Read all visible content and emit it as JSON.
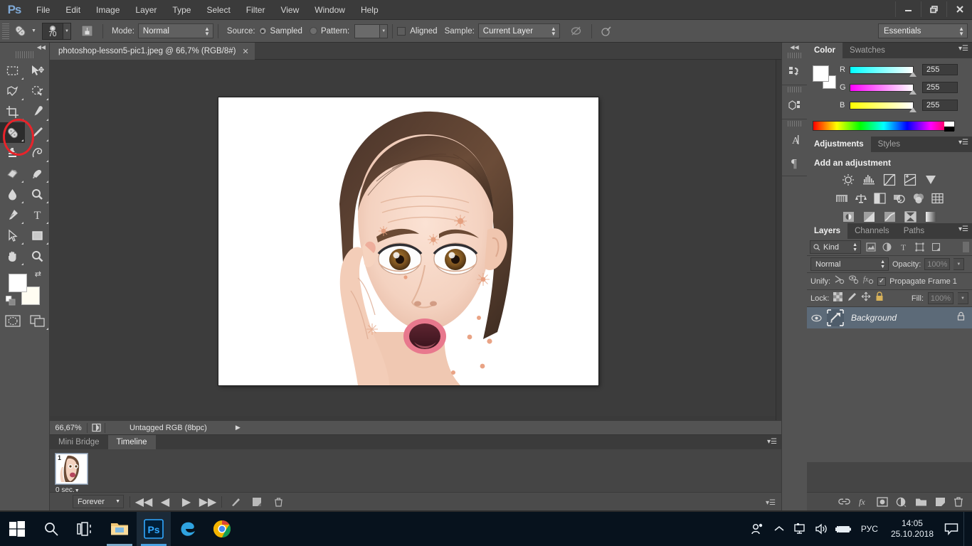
{
  "app": {
    "logo": "Ps",
    "menus": [
      "File",
      "Edit",
      "Image",
      "Layer",
      "Type",
      "Select",
      "Filter",
      "View",
      "Window",
      "Help"
    ],
    "window_controls": {
      "minimize": "—",
      "restore": "❐",
      "close": "✕"
    }
  },
  "options_bar": {
    "tool_icon": "healing-brush-icon",
    "brush_size": "70",
    "brush_preset_icon": "brush-preset-icon",
    "mode_label": "Mode:",
    "mode_value": "Normal",
    "source_label": "Source:",
    "source_sampled": "Sampled",
    "source_pattern": "Pattern:",
    "aligned_label": "Aligned",
    "sample_label": "Sample:",
    "sample_value": "Current Layer",
    "ignore_adjustment_icon": "ignore-adjustment-layers-icon",
    "airbrush_icon": "tablet-pressure-icon",
    "workspace": "Essentials"
  },
  "toolbox": {
    "tools": [
      {
        "name": "rectangular-marquee-tool",
        "selected": false
      },
      {
        "name": "move-tool",
        "selected": false
      },
      {
        "name": "lasso-tool",
        "selected": false
      },
      {
        "name": "quick-selection-tool",
        "selected": false
      },
      {
        "name": "crop-tool",
        "selected": false
      },
      {
        "name": "eyedropper-tool",
        "selected": false
      },
      {
        "name": "spot-healing-brush-tool",
        "selected": true
      },
      {
        "name": "brush-tool",
        "selected": false
      },
      {
        "name": "clone-stamp-tool",
        "selected": false
      },
      {
        "name": "history-brush-tool",
        "selected": false
      },
      {
        "name": "eraser-tool",
        "selected": false
      },
      {
        "name": "gradient-tool",
        "selected": false
      },
      {
        "name": "blur-tool",
        "selected": false
      },
      {
        "name": "dodge-tool",
        "selected": false
      },
      {
        "name": "pen-tool",
        "selected": false
      },
      {
        "name": "type-tool",
        "selected": false
      },
      {
        "name": "path-selection-tool",
        "selected": false
      },
      {
        "name": "rectangle-tool",
        "selected": false
      },
      {
        "name": "hand-tool",
        "selected": false
      },
      {
        "name": "zoom-tool",
        "selected": false
      }
    ],
    "foreground_color": "#ffffff",
    "background_color": "#fffdf2",
    "quick_mask": "quick-mask-icon",
    "screen_mode": "screen-mode-icon"
  },
  "document": {
    "tab_title": "photoshop-lesson5-pic1.jpeg @ 66,7% (RGB/8#)",
    "tab_close": "✕"
  },
  "status_bar": {
    "zoom": "66,67%",
    "doc_icon": "document-profile-icon",
    "color_profile": "Untagged RGB (8bpc)",
    "expand_arrow": "▶"
  },
  "timeline": {
    "tabs": [
      {
        "label": "Mini Bridge",
        "active": false
      },
      {
        "label": "Timeline",
        "active": true
      }
    ],
    "frames": [
      {
        "number": "1",
        "delay": "0 sec."
      }
    ],
    "loop": "Forever",
    "controls": [
      "select-first-frame",
      "select-previous-frame",
      "play-animation",
      "select-next-frame"
    ],
    "tween_icon": "tween-icon",
    "duplicate_icon": "duplicate-frame-icon",
    "delete_icon": "delete-frame-icon"
  },
  "dock_strip": {
    "icons": [
      "history-icon",
      "properties-3d-icon",
      "character-icon",
      "paragraph-icon"
    ],
    "collapse": "◀◀"
  },
  "color_panel": {
    "tabs": [
      {
        "label": "Color",
        "active": true
      },
      {
        "label": "Swatches",
        "active": false
      }
    ],
    "channels": [
      {
        "label": "R",
        "value": "255"
      },
      {
        "label": "G",
        "value": "255"
      },
      {
        "label": "B",
        "value": "255"
      }
    ]
  },
  "adjustments_panel": {
    "tabs": [
      {
        "label": "Adjustments",
        "active": true
      },
      {
        "label": "Styles",
        "active": false
      }
    ],
    "title": "Add an adjustment",
    "rows": [
      [
        "brightness-contrast-icon",
        "levels-icon",
        "curves-icon",
        "exposure-icon",
        "vibrance-icon"
      ],
      [
        "hue-saturation-icon",
        "color-balance-icon",
        "black-white-icon",
        "photo-filter-icon",
        "channel-mixer-icon",
        "color-lookup-icon"
      ],
      [
        "invert-icon",
        "posterize-icon",
        "threshold-icon",
        "selective-color-icon",
        "gradient-map-icon"
      ]
    ]
  },
  "layers_panel": {
    "tabs": [
      {
        "label": "Layers",
        "active": true
      },
      {
        "label": "Channels",
        "active": false
      },
      {
        "label": "Paths",
        "active": false
      }
    ],
    "filter_kind": "Kind",
    "filter_icons": [
      "filter-pixel-icon",
      "filter-adjustment-icon",
      "filter-type-icon",
      "filter-shape-icon",
      "filter-smart-object-icon"
    ],
    "blend_mode": "Normal",
    "opacity_label": "Opacity:",
    "opacity_value": "100%",
    "unify_label": "Unify:",
    "unify_icons": [
      "unify-position-icon",
      "unify-visibility-icon",
      "unify-style-icon"
    ],
    "propagate_label": "Propagate Frame 1",
    "propagate_checked": true,
    "lock_label": "Lock:",
    "lock_icons": [
      "lock-transparency-icon",
      "lock-image-icon",
      "lock-position-icon",
      "lock-all-icon"
    ],
    "fill_label": "Fill:",
    "fill_value": "100%",
    "layers": [
      {
        "name": "Background",
        "visible": true,
        "locked": true,
        "selected": true
      }
    ],
    "footer_icons": [
      "link-layers-icon",
      "add-layer-style-icon",
      "add-layer-mask-icon",
      "new-adjustment-layer-icon",
      "new-group-icon",
      "new-layer-icon",
      "delete-layer-icon"
    ]
  },
  "annotation": {
    "shape": "red-ellipse-highlight",
    "color": "#e8232a"
  },
  "taskbar": {
    "items": [
      {
        "name": "start-button",
        "icon": "windows-logo-icon"
      },
      {
        "name": "search-button",
        "icon": "search-icon"
      },
      {
        "name": "task-view-button",
        "icon": "task-view-icon"
      },
      {
        "name": "file-explorer-button",
        "icon": "folder-icon"
      },
      {
        "name": "photoshop-button",
        "icon": "photoshop-icon",
        "label": "Ps",
        "active": true
      },
      {
        "name": "edge-button",
        "icon": "edge-icon"
      },
      {
        "name": "chrome-button",
        "icon": "chrome-icon"
      }
    ],
    "tray": {
      "people_icon": "people-icon",
      "chevron_icon": "show-hidden-icons-icon",
      "network_icon": "network-icon",
      "volume_icon": "volume-icon",
      "battery_icon": "battery-charging-icon",
      "language": "РУС",
      "time": "14:05",
      "date": "25.10.2018",
      "action_center_icon": "action-center-icon"
    }
  }
}
